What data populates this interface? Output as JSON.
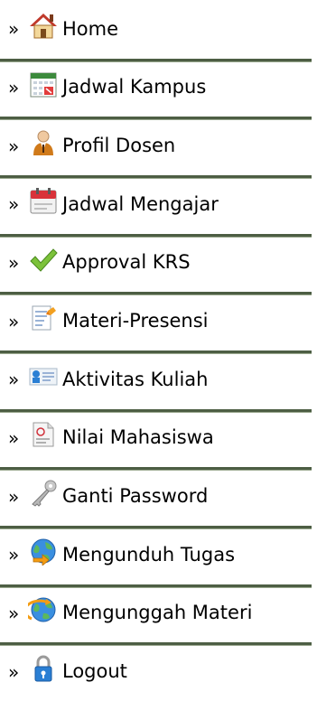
{
  "menu": {
    "arrow": "»",
    "items": [
      {
        "label": "Home",
        "icon": "home-icon"
      },
      {
        "label": "Jadwal Kampus",
        "icon": "calendar-icon"
      },
      {
        "label": "Profil Dosen",
        "icon": "lecturer-icon"
      },
      {
        "label": "Jadwal Mengajar",
        "icon": "schedule-icon"
      },
      {
        "label": "Approval KRS",
        "icon": "checkmark-icon"
      },
      {
        "label": "Materi-Presensi",
        "icon": "document-edit-icon"
      },
      {
        "label": "Aktivitas Kuliah",
        "icon": "activity-icon"
      },
      {
        "label": "Nilai Mahasiswa",
        "icon": "grade-document-icon"
      },
      {
        "label": "Ganti Password",
        "icon": "key-icon"
      },
      {
        "label": "Mengunduh Tugas",
        "icon": "globe-download-icon"
      },
      {
        "label": "Mengunggah Materi",
        "icon": "globe-upload-icon"
      },
      {
        "label": "Logout",
        "icon": "padlock-icon"
      }
    ]
  }
}
